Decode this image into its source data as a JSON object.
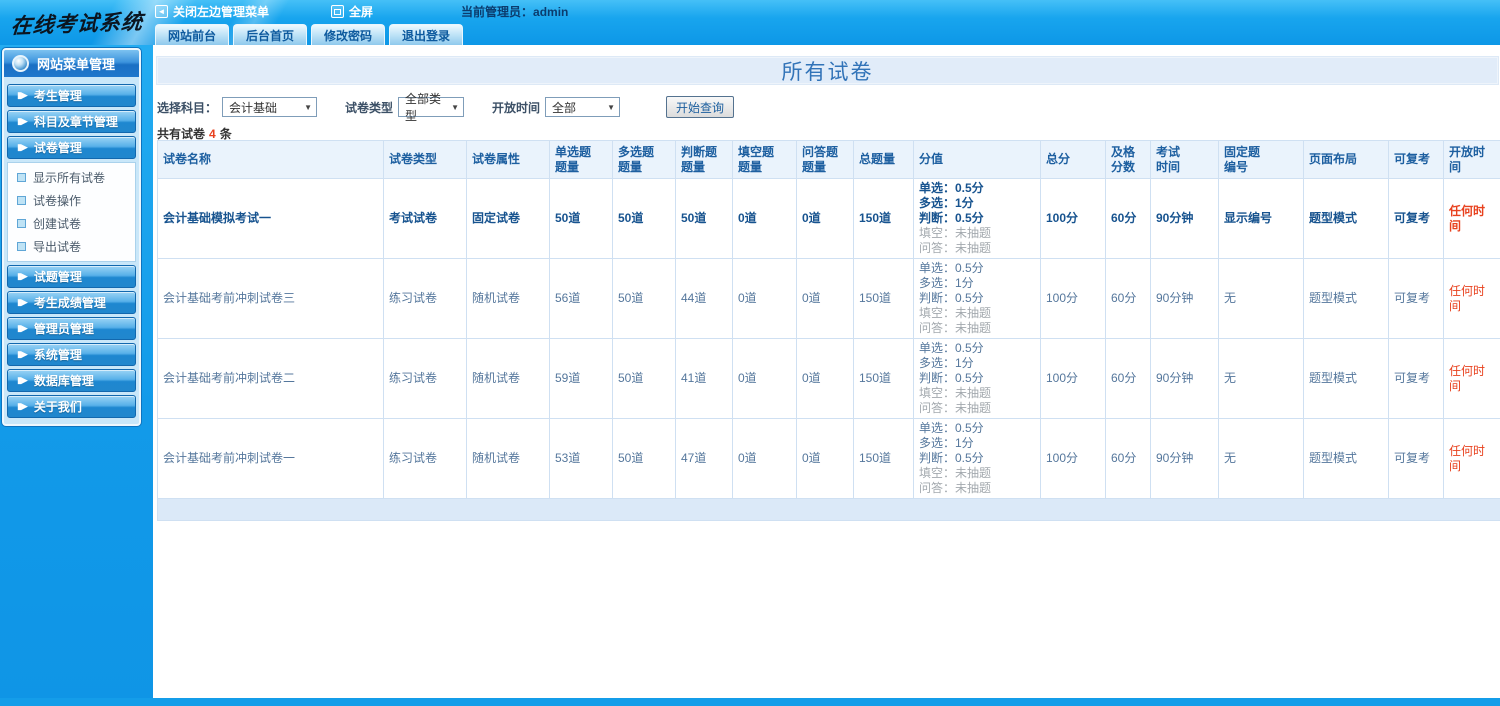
{
  "logo": {
    "title": "在线考试系统"
  },
  "topbar": {
    "close_menu": "关闭左边管理菜单",
    "fullscreen": "全屏",
    "admin_label": "当前管理员：admin"
  },
  "tabs": [
    "网站前台",
    "后台首页",
    "修改密码",
    "退出登录"
  ],
  "sidebar": {
    "header": "网站菜单管理",
    "groups_top": [
      "考生管理",
      "科目及章节管理",
      "试卷管理"
    ],
    "submenu": [
      "显示所有试卷",
      "试卷操作",
      "创建试卷",
      "导出试卷"
    ],
    "groups_bottom": [
      "试题管理",
      "考生成绩管理",
      "管理员管理",
      "系统管理",
      "数据库管理",
      "关于我们"
    ]
  },
  "main": {
    "title": "所有试卷",
    "filters": {
      "subject_label": "选择科目：",
      "subject_value": "会计基础",
      "type_label": "试卷类型",
      "type_value": "全部类型",
      "time_label": "开放时间",
      "time_value": "全部",
      "query_button": "开始查询"
    },
    "count": {
      "prefix": "共有试卷",
      "value": "4",
      "suffix": "条"
    }
  },
  "colors": {
    "accent_red": "#e8411e",
    "header_blue": "#1d5fa0",
    "rail_blue": "#129ae9"
  },
  "table": {
    "headers": [
      "试卷名称",
      "试卷类型",
      "试卷属性",
      "单选题\n题量",
      "多选题\n题量",
      "判断题\n题量",
      "填空题\n题量",
      "问答题\n题量",
      "总题量",
      "分值",
      "总分",
      "及格\n分数",
      "考试\n时间",
      "固定题\n编号",
      "页面布局",
      "可复考",
      "开放时间"
    ],
    "rows": [
      {
        "emphasis": true,
        "name": "会计基础模拟考试一",
        "type": "考试试卷",
        "attr": "固定试卷",
        "single": "50道",
        "multi": "50道",
        "judge": "50道",
        "blank": "0道",
        "qa": "0道",
        "total_q": "150道",
        "scores": [
          {
            "t": "单选：0.5分",
            "muted": false
          },
          {
            "t": "多选：1分",
            "muted": false
          },
          {
            "t": "判断：0.5分",
            "muted": false
          },
          {
            "t": "填空：未抽题",
            "muted": true
          },
          {
            "t": "问答：未抽题",
            "muted": true
          }
        ],
        "total_score": "100分",
        "pass_score": "60分",
        "time": "90分钟",
        "fixed_no": "显示编号",
        "layout": "题型模式",
        "retake": "可复考",
        "open_time": "任何时间"
      },
      {
        "emphasis": false,
        "name": "会计基础考前冲刺试卷三",
        "type": "练习试卷",
        "attr": "随机试卷",
        "single": "56道",
        "multi": "50道",
        "judge": "44道",
        "blank": "0道",
        "qa": "0道",
        "total_q": "150道",
        "scores": [
          {
            "t": "单选：0.5分",
            "muted": false
          },
          {
            "t": "多选：1分",
            "muted": false
          },
          {
            "t": "判断：0.5分",
            "muted": false
          },
          {
            "t": "填空：未抽题",
            "muted": true
          },
          {
            "t": "问答：未抽题",
            "muted": true
          }
        ],
        "total_score": "100分",
        "pass_score": "60分",
        "time": "90分钟",
        "fixed_no": "无",
        "layout": "题型模式",
        "retake": "可复考",
        "open_time": "任何时间"
      },
      {
        "emphasis": false,
        "name": "会计基础考前冲刺试卷二",
        "type": "练习试卷",
        "attr": "随机试卷",
        "single": "59道",
        "multi": "50道",
        "judge": "41道",
        "blank": "0道",
        "qa": "0道",
        "total_q": "150道",
        "scores": [
          {
            "t": "单选：0.5分",
            "muted": false
          },
          {
            "t": "多选：1分",
            "muted": false
          },
          {
            "t": "判断：0.5分",
            "muted": false
          },
          {
            "t": "填空：未抽题",
            "muted": true
          },
          {
            "t": "问答：未抽题",
            "muted": true
          }
        ],
        "total_score": "100分",
        "pass_score": "60分",
        "time": "90分钟",
        "fixed_no": "无",
        "layout": "题型模式",
        "retake": "可复考",
        "open_time": "任何时间"
      },
      {
        "emphasis": false,
        "name": "会计基础考前冲刺试卷一",
        "type": "练习试卷",
        "attr": "随机试卷",
        "single": "53道",
        "multi": "50道",
        "judge": "47道",
        "blank": "0道",
        "qa": "0道",
        "total_q": "150道",
        "scores": [
          {
            "t": "单选：0.5分",
            "muted": false
          },
          {
            "t": "多选：1分",
            "muted": false
          },
          {
            "t": "判断：0.5分",
            "muted": false
          },
          {
            "t": "填空：未抽题",
            "muted": true
          },
          {
            "t": "问答：未抽题",
            "muted": true
          }
        ],
        "total_score": "100分",
        "pass_score": "60分",
        "time": "90分钟",
        "fixed_no": "无",
        "layout": "题型模式",
        "retake": "可复考",
        "open_time": "任何时间"
      }
    ]
  }
}
